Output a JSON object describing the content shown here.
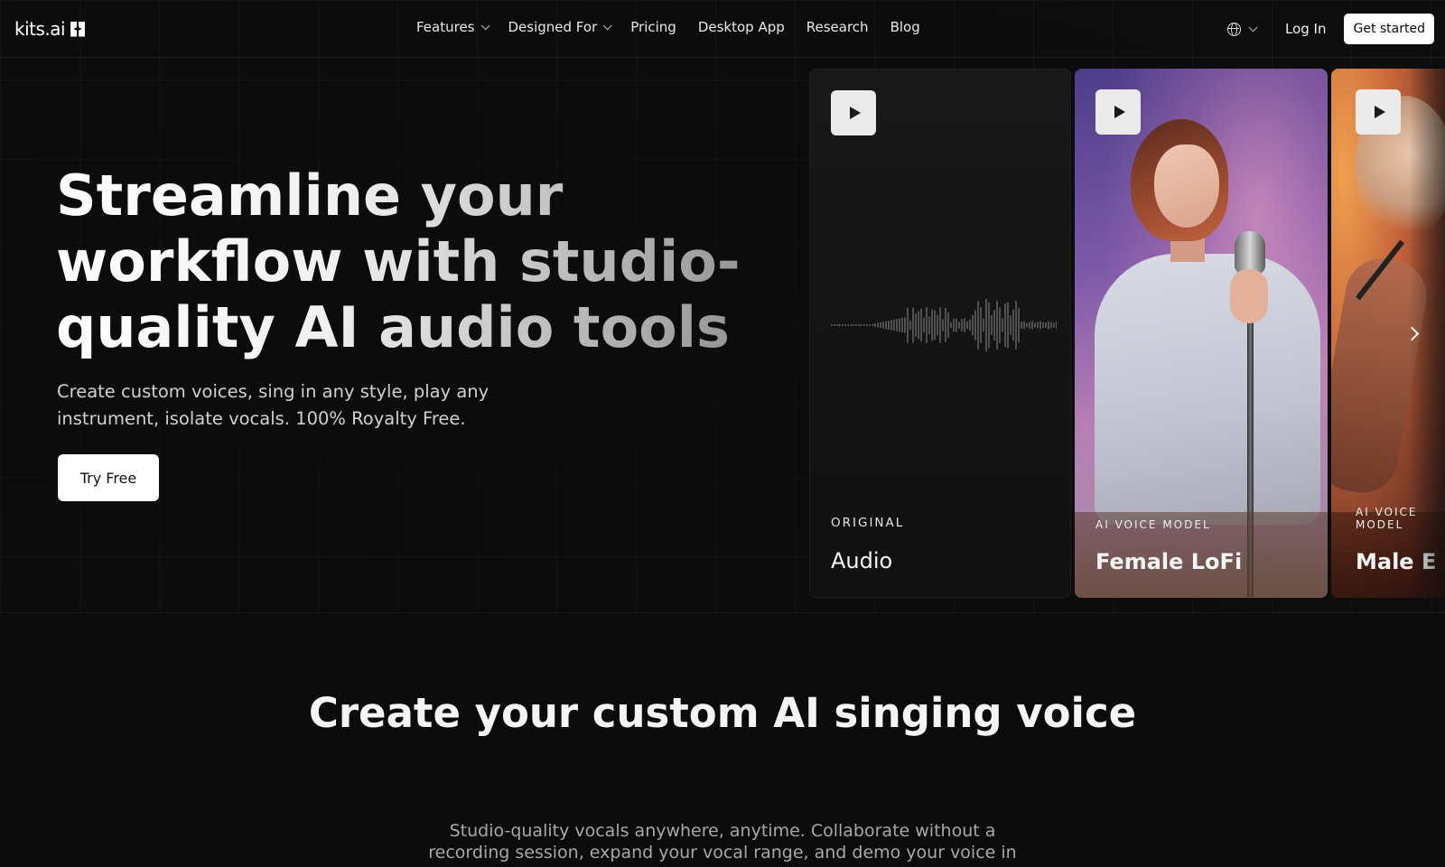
{
  "nav": {
    "logo_text": "kits.ai",
    "links": [
      {
        "label": "Features",
        "has_dropdown": true
      },
      {
        "label": "Designed For",
        "has_dropdown": true
      },
      {
        "label": "Pricing",
        "has_dropdown": false
      },
      {
        "label": "Desktop App",
        "has_dropdown": false
      },
      {
        "label": "Research",
        "has_dropdown": false
      },
      {
        "label": "Blog",
        "has_dropdown": false
      }
    ],
    "language_icon": "globe-icon",
    "login_label": "Log In",
    "cta_label": "Get started"
  },
  "hero": {
    "title": "Streamline your workflow with studio-quality AI audio tools",
    "subtitle": "Create custom voices, sing in any style, play any instrument, isolate vocals. 100% Royalty Free.",
    "cta_label": "Try Free"
  },
  "cards": [
    {
      "label": "ORIGINAL",
      "name": "Audio"
    },
    {
      "label": "AI VOICE MODEL",
      "name": "Female LoFi"
    },
    {
      "label": "AI VOICE MODEL",
      "name": "Male E"
    }
  ],
  "section": {
    "title": "Create your custom AI singing voice",
    "subtitle": "Studio-quality vocals anywhere, anytime. Collaborate without a recording session, expand your vocal range, and demo your voice in"
  },
  "colors": {
    "background": "#0b0b0b",
    "button_bg": "#ffffff",
    "button_text": "#111111"
  }
}
